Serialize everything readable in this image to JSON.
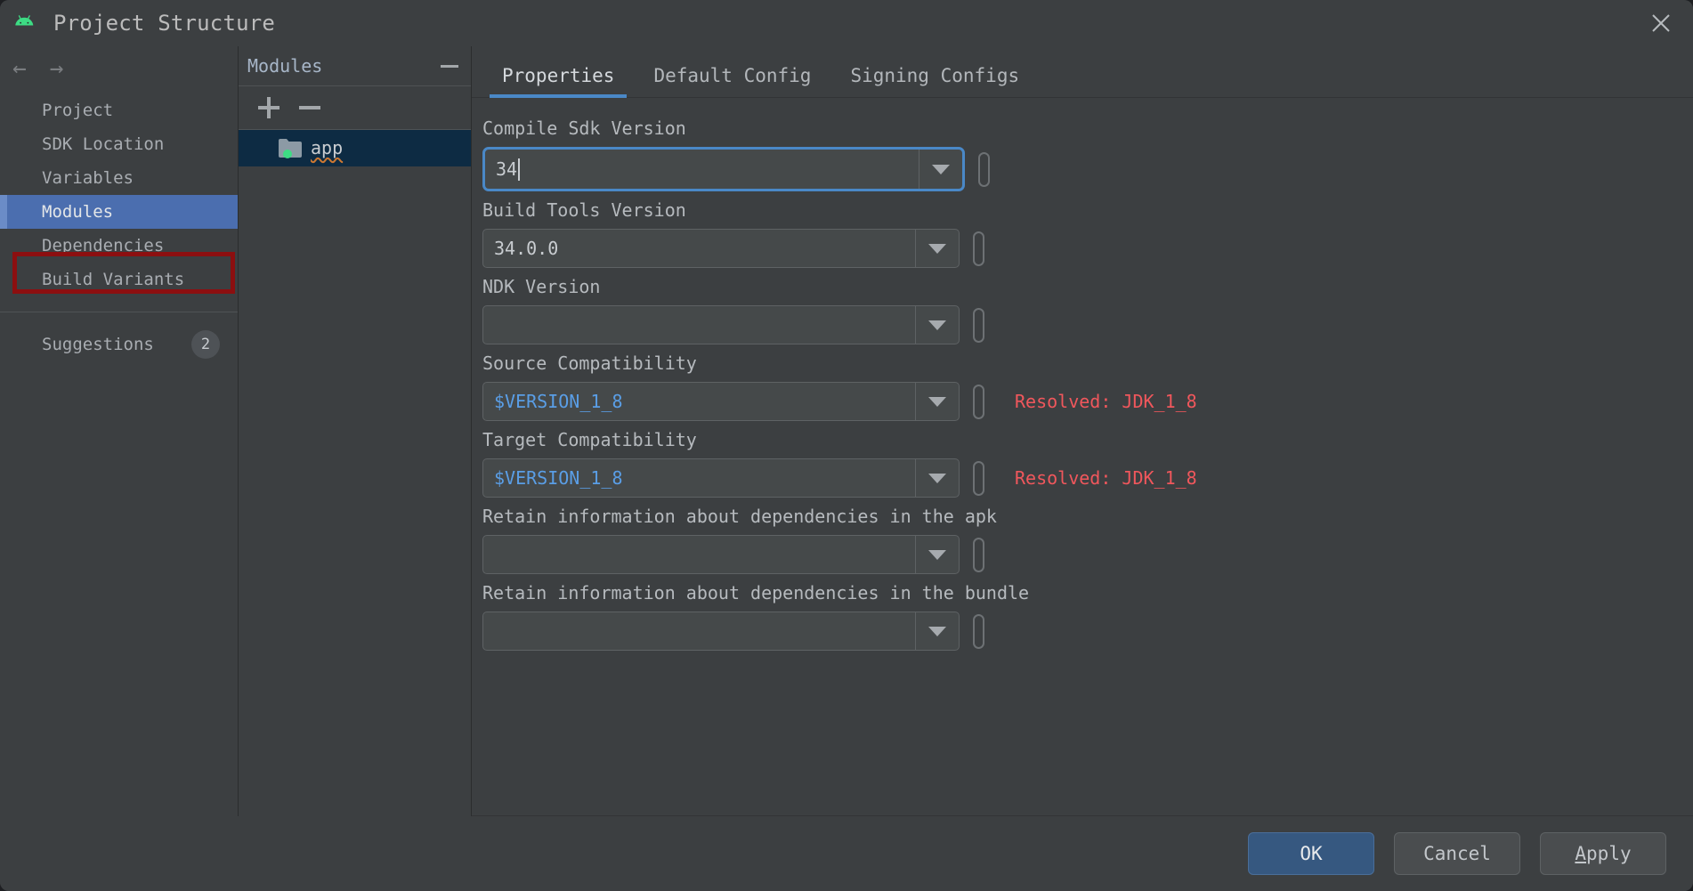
{
  "window": {
    "title": "Project Structure",
    "app_icon": "android-robot-icon",
    "close_icon": "close-icon"
  },
  "left_nav": {
    "back_icon": "arrow-left-icon",
    "forward_icon": "arrow-right-icon",
    "items": [
      {
        "label": "Project",
        "selected": false
      },
      {
        "label": "SDK Location",
        "selected": false
      },
      {
        "label": "Variables",
        "selected": false
      },
      {
        "label": "Modules",
        "selected": true
      },
      {
        "label": "Dependencies",
        "selected": false
      },
      {
        "label": "Build Variants",
        "selected": false
      }
    ],
    "suggestions": {
      "label": "Suggestions",
      "badge": "2"
    },
    "annotation_color": "#8c0f10",
    "selection_color": "#4b6eaf"
  },
  "modules_panel": {
    "title": "Modules",
    "collapse_icon": "minus-icon",
    "add_icon": "plus-icon",
    "remove_icon": "minus-icon",
    "tree": [
      {
        "label": "app",
        "icon": "module-folder-icon",
        "selected": true,
        "warning_underline": true
      }
    ]
  },
  "content": {
    "tabs": [
      {
        "label": "Properties",
        "active": true
      },
      {
        "label": "Default Config",
        "active": false
      },
      {
        "label": "Signing Configs",
        "active": false
      }
    ],
    "fields": [
      {
        "label": "Compile Sdk Version",
        "value": "34",
        "is_variable": false,
        "focused": true,
        "caret": true,
        "dropdown_icon": "chevron-down-icon",
        "variable_icon": "variable-pill-icon",
        "resolved": ""
      },
      {
        "label": "Build Tools Version",
        "value": "34.0.0",
        "is_variable": false,
        "focused": false,
        "caret": false,
        "dropdown_icon": "chevron-down-icon",
        "variable_icon": "variable-pill-icon",
        "resolved": ""
      },
      {
        "label": "NDK Version",
        "value": "",
        "is_variable": false,
        "focused": false,
        "caret": false,
        "dropdown_icon": "chevron-down-icon",
        "variable_icon": "variable-pill-icon",
        "resolved": ""
      },
      {
        "label": "Source Compatibility",
        "value": "$VERSION_1_8",
        "is_variable": true,
        "focused": false,
        "caret": false,
        "dropdown_icon": "chevron-down-icon",
        "variable_icon": "variable-pill-icon",
        "resolved": "Resolved: JDK_1_8"
      },
      {
        "label": "Target Compatibility",
        "value": "$VERSION_1_8",
        "is_variable": true,
        "focused": false,
        "caret": false,
        "dropdown_icon": "chevron-down-icon",
        "variable_icon": "variable-pill-icon",
        "resolved": "Resolved: JDK_1_8"
      },
      {
        "label": "Retain information about dependencies in the apk",
        "value": "",
        "is_variable": false,
        "focused": false,
        "caret": false,
        "dropdown_icon": "chevron-down-icon",
        "variable_icon": "variable-pill-icon",
        "resolved": ""
      },
      {
        "label": "Retain information about dependencies in the bundle",
        "value": "",
        "is_variable": false,
        "focused": false,
        "caret": false,
        "dropdown_icon": "chevron-down-icon",
        "variable_icon": "variable-pill-icon",
        "resolved": ""
      }
    ]
  },
  "footer": {
    "ok": "OK",
    "cancel": "Cancel",
    "apply_mnemonic": "A",
    "apply_rest": "pply"
  },
  "colors": {
    "accent": "#4a88c7",
    "selection": "#4b6eaf",
    "primary_button": "#365880",
    "variable_text": "#5a9ee6",
    "resolved_text": "#f0575c",
    "squiggle": "#cc7832",
    "annotation": "#8c0f10"
  }
}
